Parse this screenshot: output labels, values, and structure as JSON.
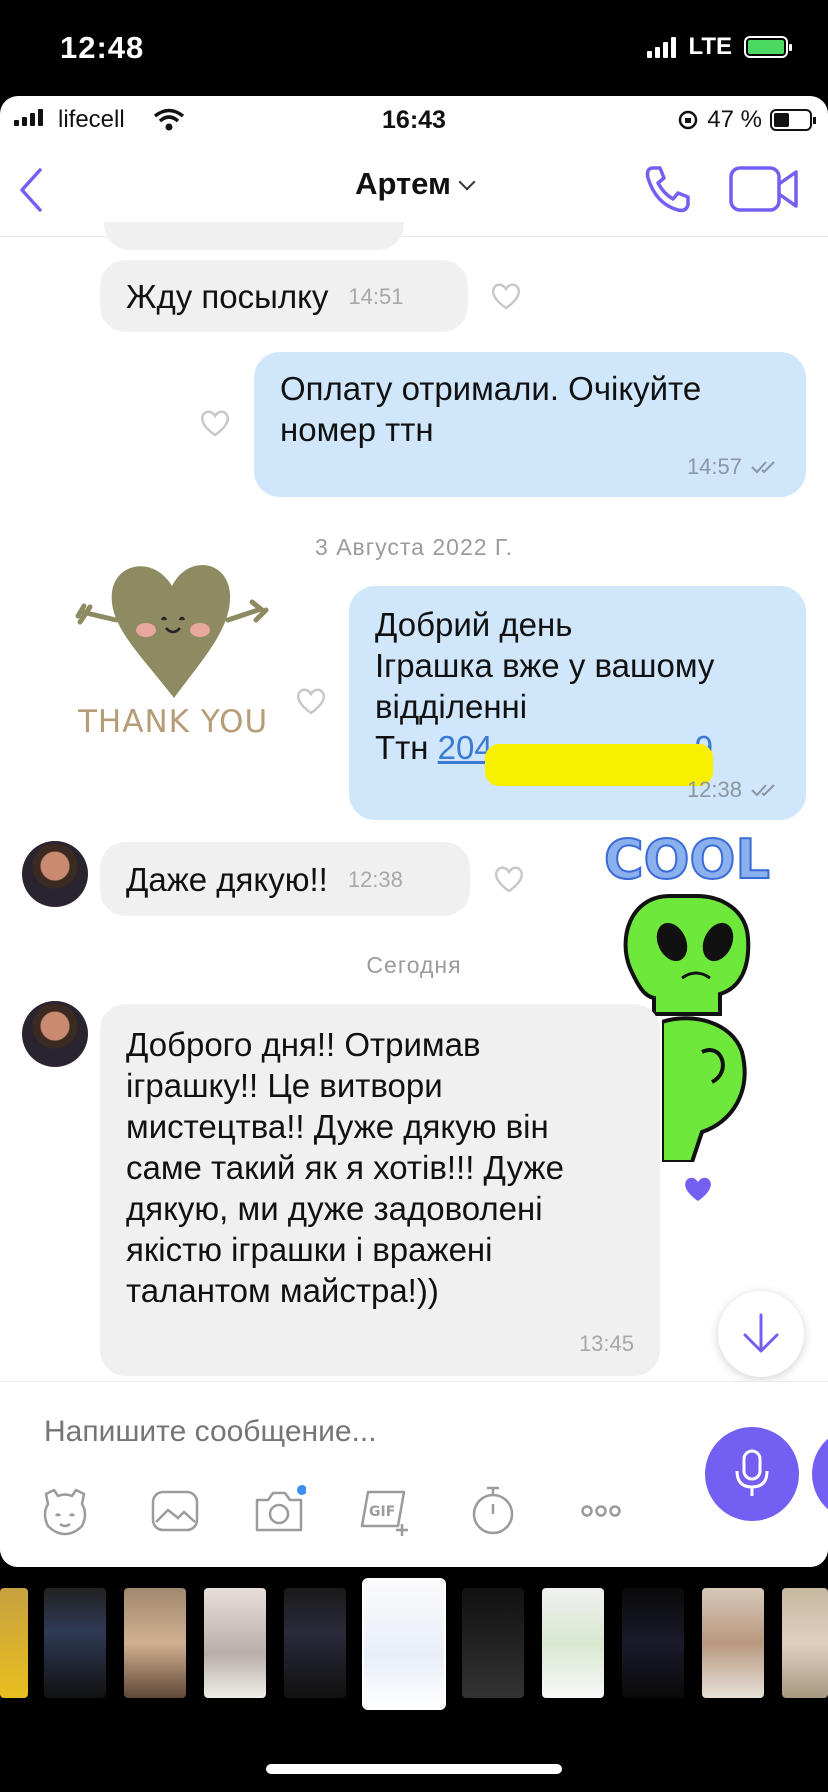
{
  "outer_status": {
    "time": "12:48",
    "network": "LTE"
  },
  "inner_status": {
    "carrier": "lifecell",
    "time": "16:43",
    "battery": "47 %"
  },
  "header": {
    "contact_name": "Артем"
  },
  "messages": [
    {
      "text": "Жду посылку",
      "time": "14:51"
    },
    {
      "text": "Оплату отримали. Очікуйте\nномер ттн",
      "time": "14:57"
    },
    {
      "date": "3 Августа 2022 Г."
    },
    {
      "sticker": "THANK YOU"
    },
    {
      "text": "Добрий день\nІграшка вже у вашому\nвідділенні\nТтн ",
      "ttn_start": "204",
      "ttn_end": "9",
      "time": "12:38"
    },
    {
      "text": "Даже дякую!!",
      "time": "12:38"
    },
    {
      "sticker": "COOL"
    },
    {
      "date": "Сегодня"
    },
    {
      "text": "Доброго дня!! Отримав\nіграшку!! Це витвори\nмистецтва!! Дуже дякую він\nсаме такий як я хотів!!! Дуже\nдякую, ми дуже задоволені\nякістю іграшки і вражені\nталантом майстра!))",
      "time": "13:45"
    }
  ],
  "composer": {
    "placeholder": "Напишите сообщение..."
  },
  "colors": {
    "accent": "#7360f2",
    "incoming": "#f0f0f0",
    "outgoing": "#cfe6fb",
    "liked_heart": "#7360f2"
  }
}
